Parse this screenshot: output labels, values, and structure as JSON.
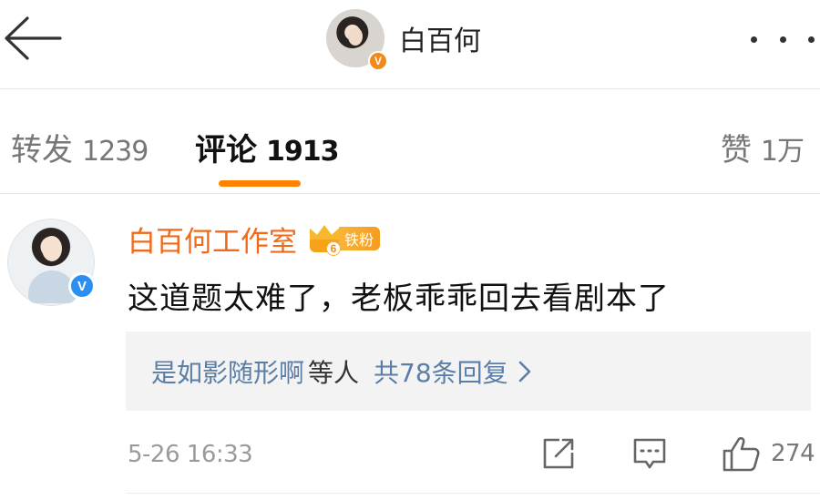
{
  "header": {
    "title": "白百何",
    "verified_mark": "V",
    "icons": {
      "back": "back-arrow-icon",
      "more": "more-dots-icon"
    }
  },
  "tabs": [
    {
      "label": "转发",
      "count": "1239",
      "active": false
    },
    {
      "label": "评论",
      "count": "1913",
      "active": true
    },
    {
      "label": "赞",
      "count": "1万",
      "active": false
    }
  ],
  "accent_color": "#ff8200",
  "comment": {
    "author": "白百何工作室",
    "author_color": "#f06a1a",
    "verified_mark": "V",
    "fan_badge": {
      "level": "6",
      "label": "铁粉"
    },
    "text": "这道题太难了，老板乖乖回去看剧本了",
    "replies": {
      "first_replier": "是如影随形啊",
      "etc": "等人",
      "total": "共78条回复"
    },
    "time": "5-26 16:33",
    "likes": "274",
    "icons": {
      "share": "share-icon",
      "reply": "comment-icon",
      "like": "thumbs-up-icon"
    }
  }
}
